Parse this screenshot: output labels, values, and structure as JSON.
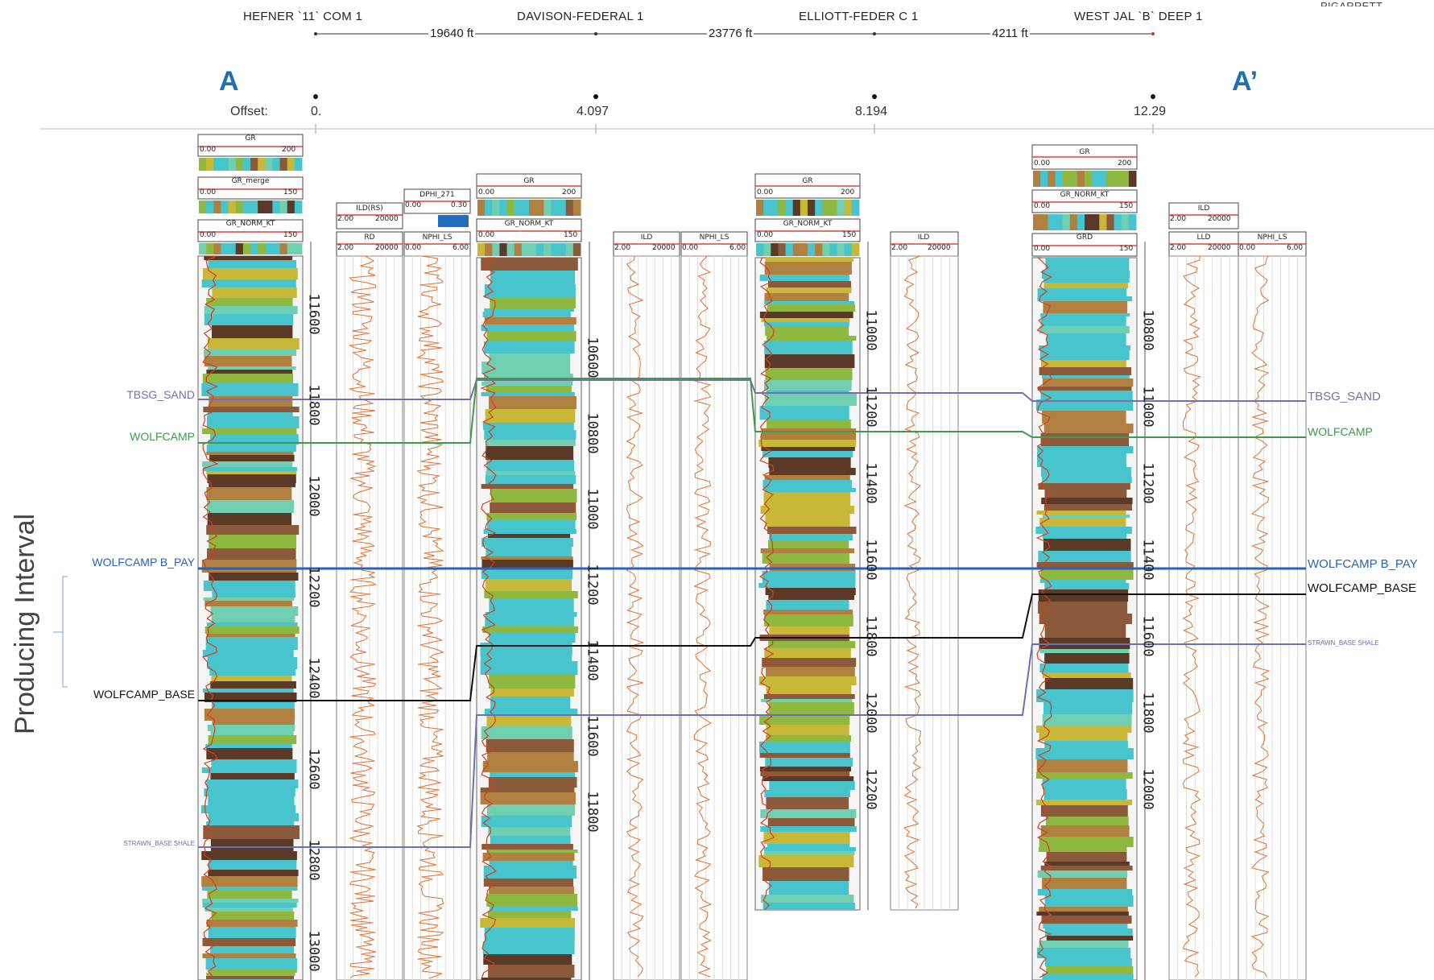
{
  "section": {
    "label_start": "A",
    "label_end": "A’",
    "producing_label": "Producing Interval",
    "top_right_text": "PIGARRETT"
  },
  "distances": [
    {
      "value": "19640 ft"
    },
    {
      "value": "23776 ft"
    },
    {
      "value": "4211 ft"
    }
  ],
  "offset_axis": {
    "label": "Offset:",
    "ticks": [
      "0.",
      "4.097",
      "8.194",
      "12.29"
    ]
  },
  "formations_left": [
    {
      "name": "TBSG_SAND",
      "color": "#7b6bb0"
    },
    {
      "name": "WOLFCAMP",
      "color": "#3f9a4a"
    },
    {
      "name": "WOLFCAMP B_PAY",
      "color": "#2a62b8"
    },
    {
      "name": "WOLFCAMP_BASE",
      "color": "#111111"
    },
    {
      "name": "STRAWN_BASE SHALE",
      "color": "#6b6fb5"
    }
  ],
  "formations_right": [
    {
      "name": "TBSG_SAND",
      "color": "#7b6bb0"
    },
    {
      "name": "WOLFCAMP",
      "color": "#3f9a4a"
    },
    {
      "name": "WOLFCAMP B_PAY",
      "color": "#2a62b8"
    },
    {
      "name": "WOLFCAMP_BASE",
      "color": "#111111"
    },
    {
      "name": "STRAWN_BASE SHALE",
      "color": "#6b6fb5"
    }
  ],
  "wells": [
    {
      "name": "HEFNER `11` COM 1",
      "tracks": [
        {
          "curve": "GR",
          "min": "0.00",
          "max": "200"
        },
        {
          "curve": "GR_merge",
          "min": "0.00",
          "max": "150"
        },
        {
          "curve": "GR_NORM_KT",
          "min": "0.00",
          "max": "150"
        }
      ],
      "res_tracks": [
        {
          "curve": "ILD(RS)",
          "min": "2.00",
          "max": "20000"
        },
        {
          "curve": "RD",
          "min": "2.00",
          "max": "20000"
        }
      ],
      "por_tracks": [
        {
          "curve": "DPHI_271",
          "min": "0.00",
          "max": "0.30"
        },
        {
          "curve": "NPHI_LS",
          "min": "0.00",
          "max": "6.00"
        }
      ],
      "depths": [
        "11600",
        "11800",
        "12000",
        "12200",
        "12400",
        "12600",
        "12800",
        "13000"
      ]
    },
    {
      "name": "DAVISON-FEDERAL 1",
      "tracks": [
        {
          "curve": "GR",
          "min": "0.00",
          "max": "200"
        },
        {
          "curve": "GR_NORM_KT",
          "min": "0.00",
          "max": "150"
        }
      ],
      "res_tracks": [
        {
          "curve": "ILD",
          "min": "2.00",
          "max": "20000"
        }
      ],
      "por_tracks": [
        {
          "curve": "NPHI_LS",
          "min": "0.00",
          "max": "6.00"
        }
      ],
      "depths": [
        "10600",
        "10800",
        "11000",
        "11200",
        "11400",
        "11600",
        "11800"
      ]
    },
    {
      "name": "ELLIOTT-FEDER C 1",
      "tracks": [
        {
          "curve": "GR",
          "min": "0.00",
          "max": "200"
        },
        {
          "curve": "GR_NORM_KT",
          "min": "0.00",
          "max": "150"
        }
      ],
      "res_tracks": [
        {
          "curve": "ILD",
          "min": "2.00",
          "max": "20000"
        }
      ],
      "depths": [
        "11000",
        "11200",
        "11400",
        "11600",
        "11800",
        "12000",
        "12200"
      ]
    },
    {
      "name": "WEST JAL `B` DEEP 1",
      "tracks": [
        {
          "curve": "GR",
          "min": "0.00",
          "max": "200"
        },
        {
          "curve": "GR_NORM_KT",
          "min": "0.00",
          "max": "150"
        },
        {
          "curve": "GRD",
          "min": "0.00",
          "max": "150"
        }
      ],
      "res_tracks": [
        {
          "curve": "ILD",
          "min": "2.00",
          "max": "20000"
        },
        {
          "curve": "LLD",
          "min": "2.00",
          "max": "20000"
        }
      ],
      "por_tracks": [
        {
          "curve": "NPHI_LS",
          "min": "0.00",
          "max": "6.00"
        }
      ],
      "depths": [
        "10800",
        "11000",
        "11200",
        "11400",
        "11600",
        "11800",
        "12000"
      ]
    }
  ],
  "colors": {
    "gr_cyan": "#47c4cc",
    "gr_brown": "#8a5a3a",
    "gr_green": "#8fb840",
    "curve": "#e07030"
  }
}
